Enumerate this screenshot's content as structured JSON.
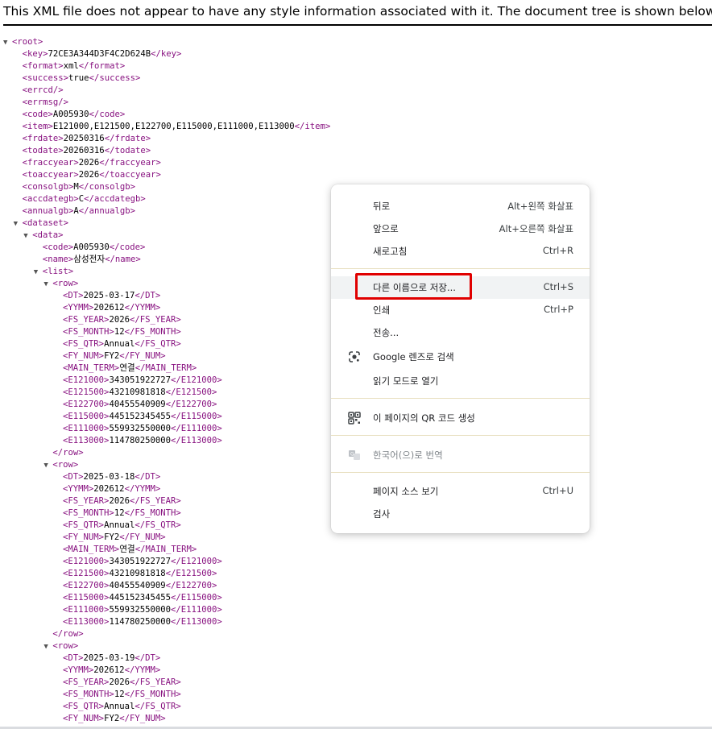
{
  "header": {
    "notice": "This XML file does not appear to have any style information associated with it. The document tree is shown below."
  },
  "tree": {
    "lines": [
      {
        "depth": 0,
        "toggle": true,
        "open": "root"
      },
      {
        "depth": 1,
        "open": "key",
        "text": "72CE3A344D3F4C2D624B",
        "close": "key"
      },
      {
        "depth": 1,
        "open": "format",
        "text": "xml",
        "close": "format"
      },
      {
        "depth": 1,
        "open": "success",
        "text": "true",
        "close": "success"
      },
      {
        "depth": 1,
        "open": "errcd/"
      },
      {
        "depth": 1,
        "open": "errmsg/"
      },
      {
        "depth": 1,
        "open": "code",
        "text": "A005930",
        "close": "code"
      },
      {
        "depth": 1,
        "open": "item",
        "text": "E121000,E121500,E122700,E115000,E111000,E113000",
        "close": "item"
      },
      {
        "depth": 1,
        "open": "frdate",
        "text": "20250316",
        "close": "frdate"
      },
      {
        "depth": 1,
        "open": "todate",
        "text": "20260316",
        "close": "todate"
      },
      {
        "depth": 1,
        "open": "fraccyear",
        "text": "2026",
        "close": "fraccyear"
      },
      {
        "depth": 1,
        "open": "toaccyear",
        "text": "2026",
        "close": "toaccyear"
      },
      {
        "depth": 1,
        "open": "consolgb",
        "text": "M",
        "close": "consolgb"
      },
      {
        "depth": 1,
        "open": "accdategb",
        "text": "C",
        "close": "accdategb"
      },
      {
        "depth": 1,
        "open": "annualgb",
        "text": "A",
        "close": "annualgb"
      },
      {
        "depth": 1,
        "toggle": true,
        "open": "dataset"
      },
      {
        "depth": 2,
        "toggle": true,
        "open": "data"
      },
      {
        "depth": 3,
        "open": "code",
        "text": "A005930",
        "close": "code"
      },
      {
        "depth": 3,
        "open": "name",
        "text": "삼성전자",
        "close": "name"
      },
      {
        "depth": 3,
        "toggle": true,
        "open": "list"
      },
      {
        "depth": 4,
        "toggle": true,
        "open": "row"
      },
      {
        "depth": 5,
        "open": "DT",
        "text": "2025-03-17",
        "close": "DT"
      },
      {
        "depth": 5,
        "open": "YYMM",
        "text": "202612",
        "close": "YYMM"
      },
      {
        "depth": 5,
        "open": "FS_YEAR",
        "text": "2026",
        "close": "FS_YEAR"
      },
      {
        "depth": 5,
        "open": "FS_MONTH",
        "text": "12",
        "close": "FS_MONTH"
      },
      {
        "depth": 5,
        "open": "FS_QTR",
        "text": "Annual",
        "close": "FS_QTR"
      },
      {
        "depth": 5,
        "open": "FY_NUM",
        "text": "FY2",
        "close": "FY_NUM"
      },
      {
        "depth": 5,
        "open": "MAIN_TERM",
        "text": "연결",
        "close": "MAIN_TERM"
      },
      {
        "depth": 5,
        "open": "E121000",
        "text": "343051922727",
        "close": "E121000"
      },
      {
        "depth": 5,
        "open": "E121500",
        "text": "43210981818",
        "close": "E121500"
      },
      {
        "depth": 5,
        "open": "E122700",
        "text": "40455540909",
        "close": "E122700"
      },
      {
        "depth": 5,
        "open": "E115000",
        "text": "445152345455",
        "close": "E115000"
      },
      {
        "depth": 5,
        "open": "E111000",
        "text": "559932550000",
        "close": "E111000"
      },
      {
        "depth": 5,
        "open": "E113000",
        "text": "114780250000",
        "close": "E113000"
      },
      {
        "depth": 4,
        "endtag": "row"
      },
      {
        "depth": 4,
        "toggle": true,
        "open": "row"
      },
      {
        "depth": 5,
        "open": "DT",
        "text": "2025-03-18",
        "close": "DT"
      },
      {
        "depth": 5,
        "open": "YYMM",
        "text": "202612",
        "close": "YYMM"
      },
      {
        "depth": 5,
        "open": "FS_YEAR",
        "text": "2026",
        "close": "FS_YEAR"
      },
      {
        "depth": 5,
        "open": "FS_MONTH",
        "text": "12",
        "close": "FS_MONTH"
      },
      {
        "depth": 5,
        "open": "FS_QTR",
        "text": "Annual",
        "close": "FS_QTR"
      },
      {
        "depth": 5,
        "open": "FY_NUM",
        "text": "FY2",
        "close": "FY_NUM"
      },
      {
        "depth": 5,
        "open": "MAIN_TERM",
        "text": "연결",
        "close": "MAIN_TERM"
      },
      {
        "depth": 5,
        "open": "E121000",
        "text": "343051922727",
        "close": "E121000"
      },
      {
        "depth": 5,
        "open": "E121500",
        "text": "43210981818",
        "close": "E121500"
      },
      {
        "depth": 5,
        "open": "E122700",
        "text": "40455540909",
        "close": "E122700"
      },
      {
        "depth": 5,
        "open": "E115000",
        "text": "445152345455",
        "close": "E115000"
      },
      {
        "depth": 5,
        "open": "E111000",
        "text": "559932550000",
        "close": "E111000"
      },
      {
        "depth": 5,
        "open": "E113000",
        "text": "114780250000",
        "close": "E113000"
      },
      {
        "depth": 4,
        "endtag": "row"
      },
      {
        "depth": 4,
        "toggle": true,
        "open": "row"
      },
      {
        "depth": 5,
        "open": "DT",
        "text": "2025-03-19",
        "close": "DT"
      },
      {
        "depth": 5,
        "open": "YYMM",
        "text": "202612",
        "close": "YYMM"
      },
      {
        "depth": 5,
        "open": "FS_YEAR",
        "text": "2026",
        "close": "FS_YEAR"
      },
      {
        "depth": 5,
        "open": "FS_MONTH",
        "text": "12",
        "close": "FS_MONTH"
      },
      {
        "depth": 5,
        "open": "FS_QTR",
        "text": "Annual",
        "close": "FS_QTR"
      },
      {
        "depth": 5,
        "open": "FY_NUM",
        "text": "FY2",
        "close": "FY_NUM"
      }
    ]
  },
  "context_menu": {
    "back": {
      "label": "뒤로",
      "shortcut": "Alt+왼쪽 화살표"
    },
    "forward": {
      "label": "앞으로",
      "shortcut": "Alt+오른쪽 화살표"
    },
    "reload": {
      "label": "새로고침",
      "shortcut": "Ctrl+R"
    },
    "save_as": {
      "label": "다른 이름으로 저장...",
      "shortcut": "Ctrl+S"
    },
    "print": {
      "label": "인쇄",
      "shortcut": "Ctrl+P"
    },
    "send": {
      "label": "전송..."
    },
    "lens": {
      "label": "Google 렌즈로 검색",
      "icon": "google-lens-icon"
    },
    "reading_mode": {
      "label": "읽기 모드로 열기"
    },
    "qr": {
      "label": "이 페이지의 QR 코드 생성",
      "icon": "qr-code-icon"
    },
    "translate": {
      "label": "한국어(으)로 번역",
      "icon": "translate-icon"
    },
    "view_source": {
      "label": "페이지 소스 보기",
      "shortcut": "Ctrl+U"
    },
    "inspect": {
      "label": "검사"
    }
  },
  "colors": {
    "tag": "#881280",
    "highlight_box": "#e00000",
    "menu_hover": "#f1f3f4"
  }
}
